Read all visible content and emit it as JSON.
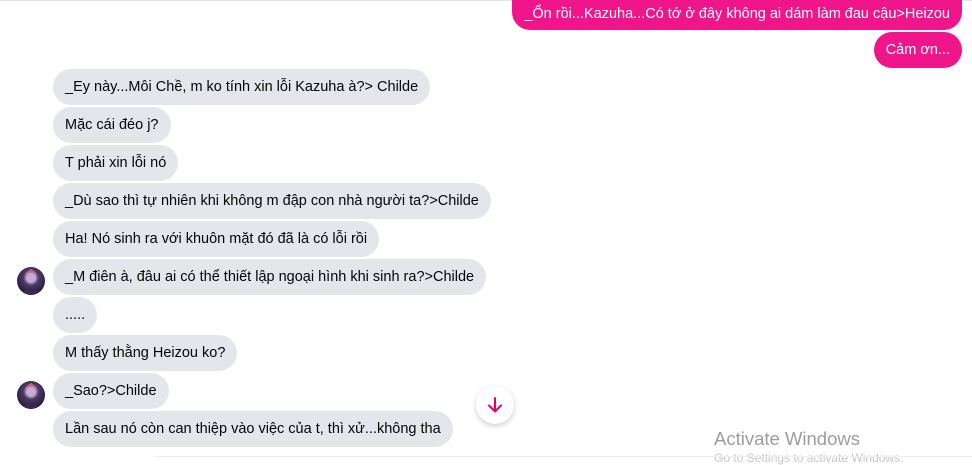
{
  "messages": [
    {
      "side": "out",
      "text": "_Ổn rồi...Kazuha...Có tớ ở đây không ai dám làm đau cậu>Heizou"
    },
    {
      "side": "out",
      "text": "Cảm ơn..."
    },
    {
      "side": "in",
      "text": "_Ey này...Môi Chề, m ko tính xin lỗi Kazuha à?> Childe"
    },
    {
      "side": "in",
      "text": "Mặc cái đéo j?"
    },
    {
      "side": "in",
      "text": "T phải xin lỗi nó"
    },
    {
      "side": "in",
      "text": "_Dù sao thì tự nhiên khi không m đập con nhà người ta?>Childe"
    },
    {
      "side": "in",
      "text": "Ha! Nó sinh ra với khuôn mặt đó đã là có lỗi rồi"
    },
    {
      "side": "in",
      "text": "_M điên à, đâu ai có thể thiết lập ngoại hình khi sinh ra?>Childe"
    },
    {
      "side": "in",
      "text": "....."
    },
    {
      "side": "in",
      "text": "M thấy thằng Heizou ko?"
    },
    {
      "side": "in",
      "text": "_Sao?>Childe"
    },
    {
      "side": "in",
      "text": "Lần sau nó còn can thiệp vào việc  của t, thì xử...không tha"
    }
  ],
  "scroll_button": {
    "icon": "arrow-down-icon"
  },
  "watermark": {
    "title": "Activate Windows",
    "subtitle": "Go to Settings to activate Windows."
  },
  "colors": {
    "outgoing": "#f0158a",
    "incoming": "#e4e6eb",
    "accent_icon": "#e5006a"
  }
}
